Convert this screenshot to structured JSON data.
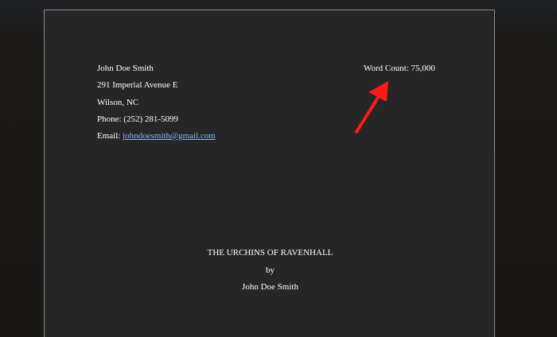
{
  "author": {
    "name": "John Doe Smith",
    "address": "291 Imperial Avenue E",
    "city": "Wilson, NC",
    "phone": "Phone: (252) 281-5099",
    "email_label": "Email: ",
    "email": "johndoesmith@gmail.com"
  },
  "word_count": "Word Count: 75,000",
  "title_block": {
    "title": "THE URCHINS OF RAVENHALL",
    "by": "by",
    "author": "John Doe Smith"
  },
  "annotation": {
    "icon": "red-arrow-icon",
    "color": "#ff1a1a"
  },
  "colors": {
    "page_bg": "#262626",
    "text": "#ffffff",
    "link": "#8ab4f8"
  }
}
